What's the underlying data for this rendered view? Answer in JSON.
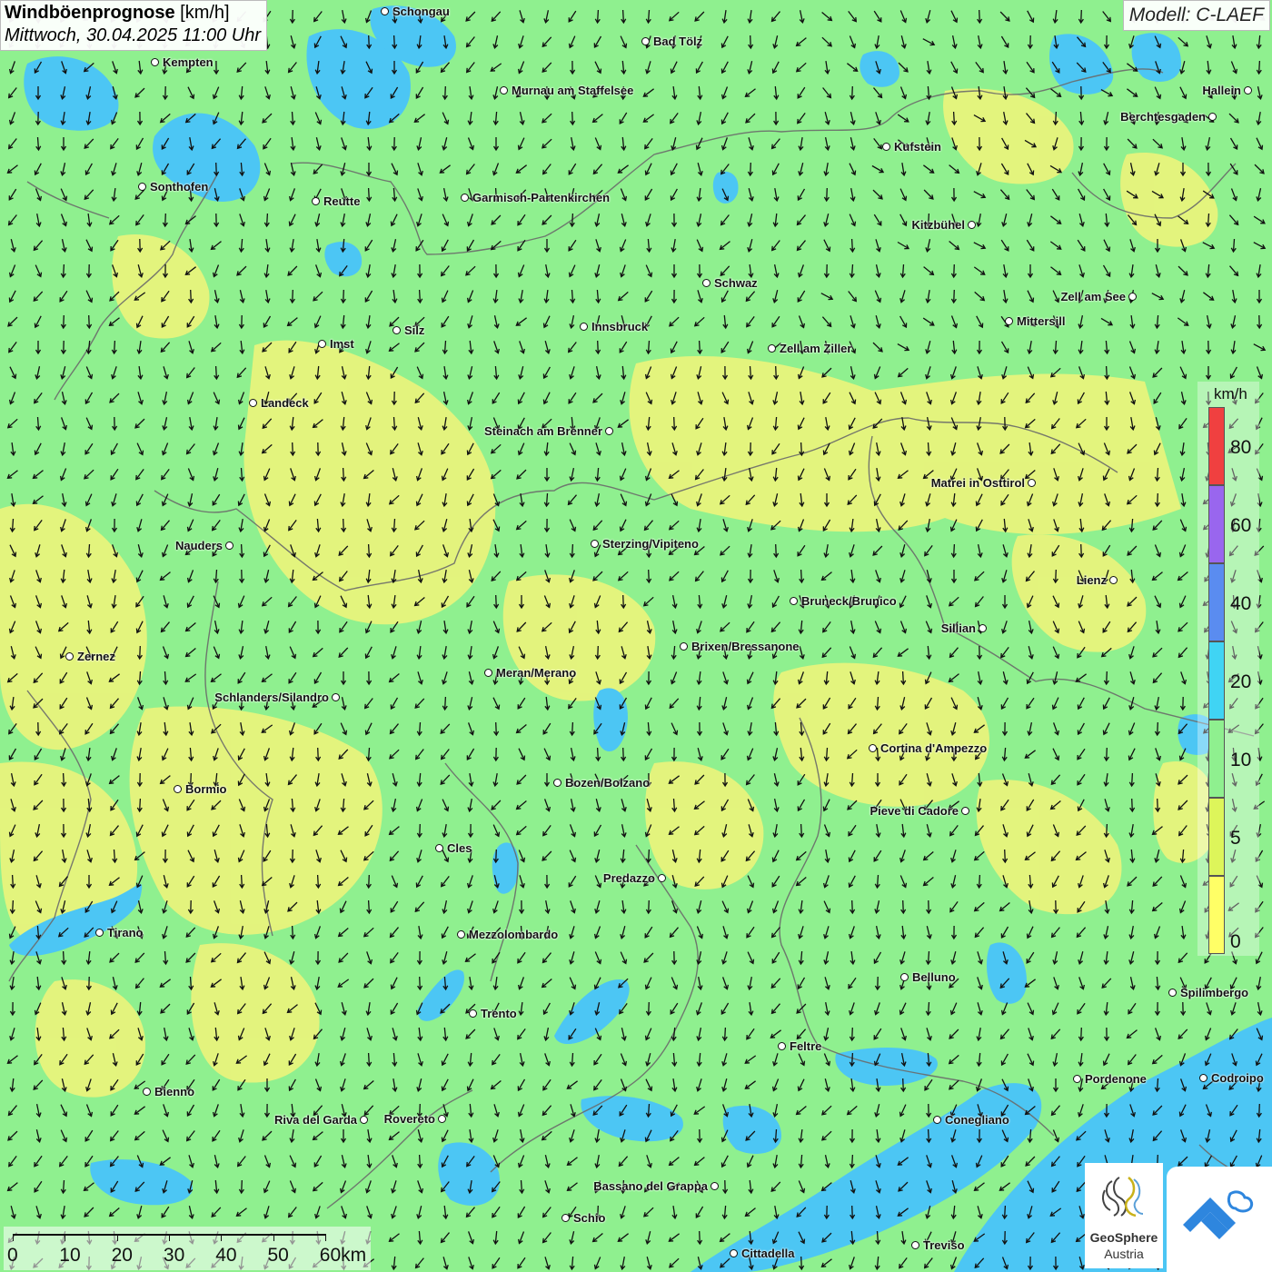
{
  "title": {
    "main": "Windböenprognose",
    "unit": "[km/h]",
    "datetime": "Mittwoch, 30.04.2025 11:00 Uhr"
  },
  "model": "Modell: C-LAEF",
  "legend": {
    "unit": "km/h",
    "colors": [
      "#ffff66",
      "#ddf55a",
      "#8ff08f",
      "#40d4f4",
      "#5a8cf0",
      "#9966ee",
      "#f04040"
    ],
    "labels": [
      "0",
      "5",
      "10",
      "20",
      "40",
      "60",
      "80"
    ]
  },
  "scale_bar": {
    "labels": [
      "0",
      "10",
      "20",
      "30",
      "40",
      "50",
      "60km"
    ]
  },
  "logo": {
    "name": "GeoSphere",
    "country": "Austria"
  },
  "cities": [
    {
      "name": "Schongau"
    },
    {
      "name": "Bad Tölz"
    },
    {
      "name": "Kempten"
    },
    {
      "name": "Murnau am Staffelsee"
    },
    {
      "name": "Hallein"
    },
    {
      "name": "Berchtesgaden"
    },
    {
      "name": "Kufstein"
    },
    {
      "name": "Sonthofen"
    },
    {
      "name": "Reutte"
    },
    {
      "name": "Garmisch-Partenkirchen"
    },
    {
      "name": "Kitzbühel"
    },
    {
      "name": "Schwaz"
    },
    {
      "name": "Zell am See"
    },
    {
      "name": "Mittersill"
    },
    {
      "name": "Silz"
    },
    {
      "name": "Innsbruck"
    },
    {
      "name": "Imst"
    },
    {
      "name": "Zell am Ziller"
    },
    {
      "name": "Landeck"
    },
    {
      "name": "Steinach am Brenner"
    },
    {
      "name": "Matrei in Osttirol"
    },
    {
      "name": "Nauders"
    },
    {
      "name": "Sterzing/Vipiteno"
    },
    {
      "name": "Lienz"
    },
    {
      "name": "Bruneck/Brunico"
    },
    {
      "name": "Sillian"
    },
    {
      "name": "Zernez"
    },
    {
      "name": "Brixen/Bressanone"
    },
    {
      "name": "Meran/Merano"
    },
    {
      "name": "Schlanders/Silandro"
    },
    {
      "name": "Cortina d'Ampezzo"
    },
    {
      "name": "Bozen/Bolzano"
    },
    {
      "name": "Bormio"
    },
    {
      "name": "Pieve di Cadore"
    },
    {
      "name": "Cles"
    },
    {
      "name": "Predazzo"
    },
    {
      "name": "Tirano"
    },
    {
      "name": "Mezzolombardo"
    },
    {
      "name": "Belluno"
    },
    {
      "name": "Spilimbergo"
    },
    {
      "name": "Trento"
    },
    {
      "name": "Feltre"
    },
    {
      "name": "Pordenone"
    },
    {
      "name": "Codroipo"
    },
    {
      "name": "Bienno"
    },
    {
      "name": "Riva del Garda"
    },
    {
      "name": "Rovereto"
    },
    {
      "name": "Conegliano"
    },
    {
      "name": "Bassano del Grappa"
    },
    {
      "name": "Schio"
    },
    {
      "name": "Treviso"
    },
    {
      "name": "Cittadella"
    }
  ]
}
